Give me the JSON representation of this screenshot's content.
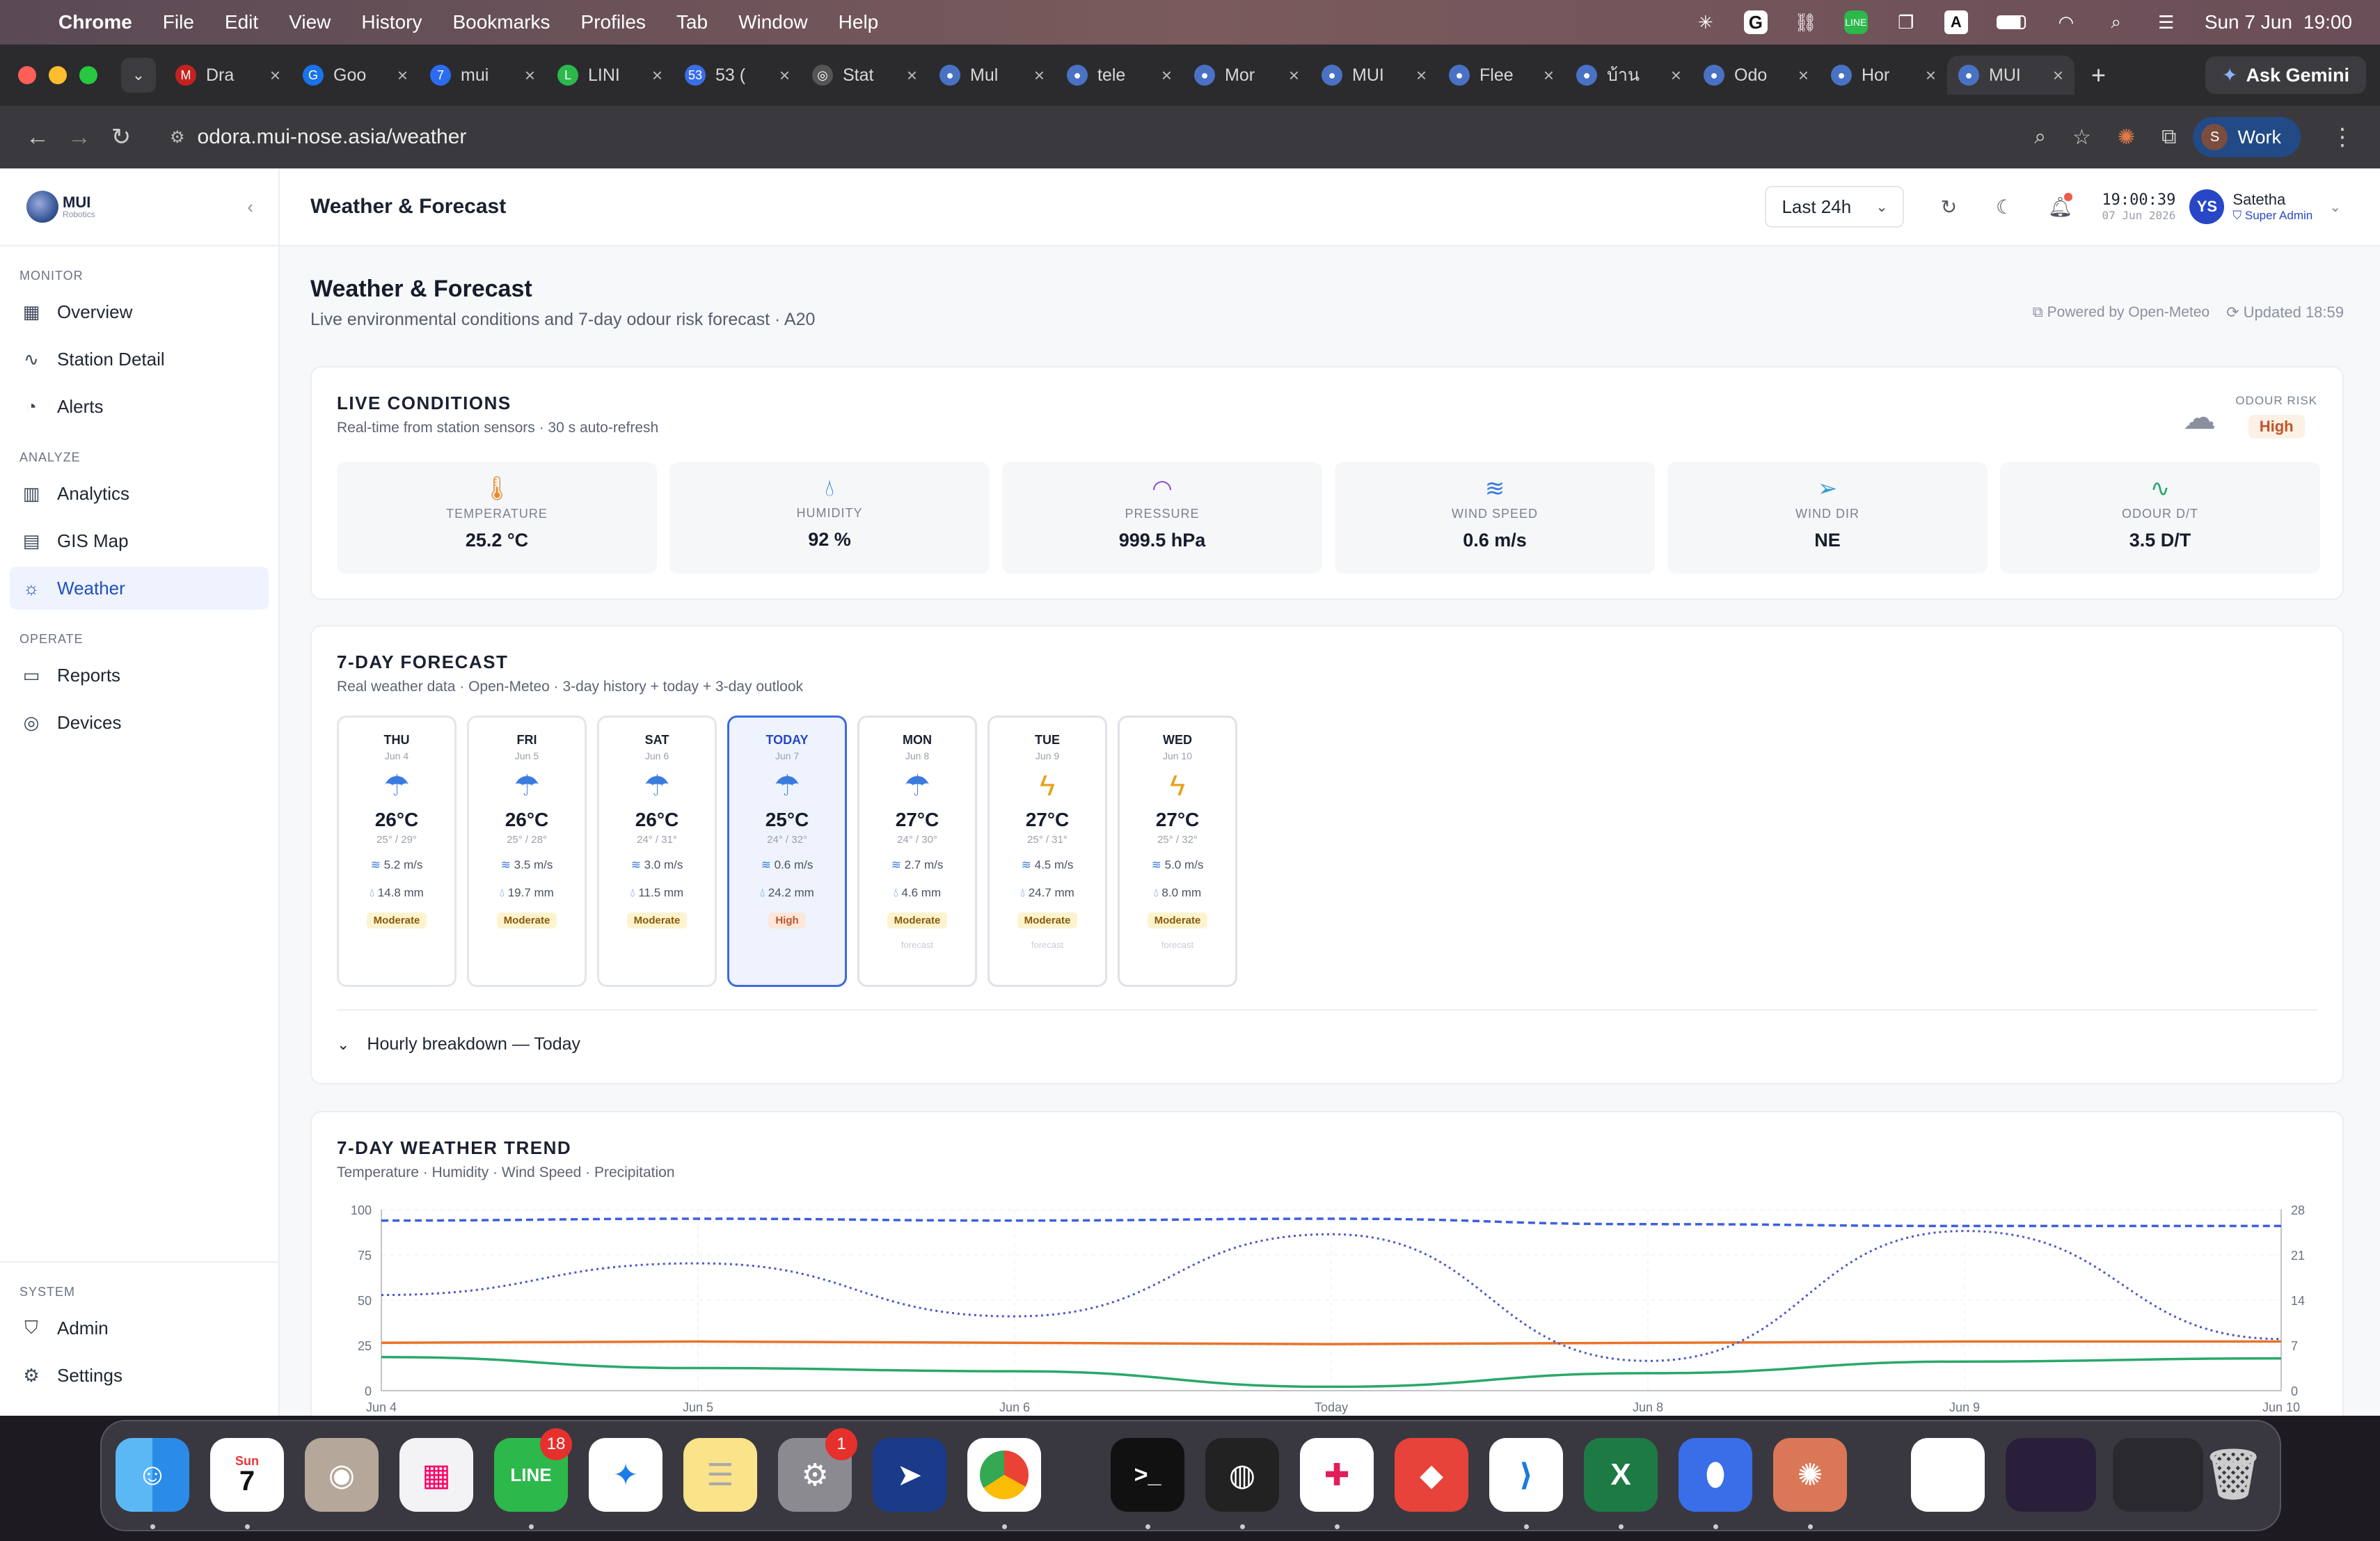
{
  "menubar": {
    "app": "Chrome",
    "items": [
      "File",
      "Edit",
      "View",
      "History",
      "Bookmarks",
      "Profiles",
      "Tab",
      "Window",
      "Help"
    ],
    "date": "Sun 7 Jun",
    "time": "19:00",
    "input_indicator": "A"
  },
  "browser": {
    "tabs": [
      {
        "title": "Dra",
        "color": "#c5221f",
        "glyph": "M"
      },
      {
        "title": "Goo",
        "color": "#1a73e8",
        "glyph": "G"
      },
      {
        "title": "mui",
        "color": "#2b6cf0",
        "glyph": "7"
      },
      {
        "title": "LINI",
        "color": "#2db84c",
        "glyph": "L"
      },
      {
        "title": "53 (",
        "color": "#3a6ee8",
        "glyph": "53"
      },
      {
        "title": "Stat",
        "color": "#555",
        "glyph": "◎"
      },
      {
        "title": "Mul",
        "color": "#4a72c4",
        "glyph": "●"
      },
      {
        "title": "tele",
        "color": "#4a72c4",
        "glyph": "●"
      },
      {
        "title": "Mor",
        "color": "#4a72c4",
        "glyph": "●"
      },
      {
        "title": "MUI",
        "color": "#4a72c4",
        "glyph": "●"
      },
      {
        "title": "Flee",
        "color": "#4a72c4",
        "glyph": "●"
      },
      {
        "title": "บ้าน",
        "color": "#4a72c4",
        "glyph": "●"
      },
      {
        "title": "Odo",
        "color": "#4a72c4",
        "glyph": "●"
      },
      {
        "title": "Hor",
        "color": "#4a72c4",
        "glyph": "●"
      },
      {
        "title": "MUI",
        "color": "#4a72c4",
        "glyph": "●",
        "active": true
      }
    ],
    "gemini": "Ask Gemini",
    "url": "odora.mui-nose.asia/weather",
    "profile": "Work",
    "profile_initial": "S"
  },
  "sidebar": {
    "brand": "MUI",
    "brand_sub": "Robotics",
    "sections": [
      {
        "title": "MONITOR",
        "items": [
          {
            "label": "Overview",
            "icon": "grid-icon"
          },
          {
            "label": "Station Detail",
            "icon": "pulse-icon"
          },
          {
            "label": "Alerts",
            "icon": "bell-icon"
          }
        ]
      },
      {
        "title": "ANALYZE",
        "items": [
          {
            "label": "Analytics",
            "icon": "bar-chart-icon"
          },
          {
            "label": "GIS Map",
            "icon": "map-icon"
          },
          {
            "label": "Weather",
            "icon": "cloud-sun-icon",
            "active": true
          }
        ]
      },
      {
        "title": "OPERATE",
        "items": [
          {
            "label": "Reports",
            "icon": "document-icon"
          },
          {
            "label": "Devices",
            "icon": "cpu-icon"
          }
        ]
      }
    ],
    "system": {
      "title": "SYSTEM",
      "items": [
        {
          "label": "Admin",
          "icon": "shield-icon"
        },
        {
          "label": "Settings",
          "icon": "gear-icon"
        }
      ]
    }
  },
  "topbar": {
    "title": "Weather & Forecast",
    "range": "Last 24h",
    "time": "19:00:39",
    "date": "07 Jun 2026",
    "user_initials": "YS",
    "user_name": "Satetha",
    "user_role": "Super Admin"
  },
  "page": {
    "title": "Weather & Forecast",
    "subtitle": "Live environmental conditions and 7-day odour risk forecast · A20",
    "powered": "Powered by Open-Meteo",
    "updated": "Updated 18:59"
  },
  "live": {
    "title": "LIVE CONDITIONS",
    "subtitle": "Real-time from station sensors · 30 s auto-refresh",
    "odour_risk_label": "ODOUR RISK",
    "odour_risk_value": "High",
    "stats": [
      {
        "label": "TEMPERATURE",
        "value": "25.2 °C",
        "icon": "thermometer-icon",
        "color": "#e8892c"
      },
      {
        "label": "HUMIDITY",
        "value": "92 %",
        "icon": "droplets-icon",
        "color": "#3a7be0"
      },
      {
        "label": "PRESSURE",
        "value": "999.5 hPa",
        "icon": "gauge-icon",
        "color": "#8a4ad0"
      },
      {
        "label": "WIND SPEED",
        "value": "0.6 m/s",
        "icon": "wind-icon",
        "color": "#3a7be0"
      },
      {
        "label": "WIND DIR",
        "value": "NE",
        "icon": "navigation-icon",
        "color": "#3a9ad0"
      },
      {
        "label": "ODOUR D/T",
        "value": "3.5 D/T",
        "icon": "activity-icon",
        "color": "#2aa86a"
      }
    ]
  },
  "forecast": {
    "title": "7-DAY FORECAST",
    "subtitle": "Real weather data · Open-Meteo · 3-day history + today + 3-day outlook",
    "days": [
      {
        "day": "THU",
        "date": "Jun 4",
        "icon": "rain",
        "temp": "26°C",
        "range": "25° / 29°",
        "wind": "5.2 m/s",
        "rain": "14.8 mm",
        "level": "Moderate"
      },
      {
        "day": "FRI",
        "date": "Jun 5",
        "icon": "rain",
        "temp": "26°C",
        "range": "25° / 28°",
        "wind": "3.5 m/s",
        "rain": "19.7 mm",
        "level": "Moderate"
      },
      {
        "day": "SAT",
        "date": "Jun 6",
        "icon": "rain",
        "temp": "26°C",
        "range": "24° / 31°",
        "wind": "3.0 m/s",
        "rain": "11.5 mm",
        "level": "Moderate"
      },
      {
        "day": "TODAY",
        "date": "Jun 7",
        "icon": "rain",
        "temp": "25°C",
        "range": "24° / 32°",
        "wind": "0.6 m/s",
        "rain": "24.2 mm",
        "level": "High",
        "today": true
      },
      {
        "day": "MON",
        "date": "Jun 8",
        "icon": "rain",
        "temp": "27°C",
        "range": "24° / 30°",
        "wind": "2.7 m/s",
        "rain": "4.6 mm",
        "level": "Moderate",
        "note": "forecast"
      },
      {
        "day": "TUE",
        "date": "Jun 9",
        "icon": "storm",
        "temp": "27°C",
        "range": "25° / 31°",
        "wind": "4.5 m/s",
        "rain": "24.7 mm",
        "level": "Moderate",
        "note": "forecast"
      },
      {
        "day": "WED",
        "date": "Jun 10",
        "icon": "storm",
        "temp": "27°C",
        "range": "25° / 32°",
        "wind": "5.0 m/s",
        "rain": "8.0 mm",
        "level": "Moderate",
        "note": "forecast"
      }
    ],
    "hourly": "Hourly breakdown — Today"
  },
  "trend": {
    "title": "7-DAY WEATHER TREND",
    "subtitle": "Temperature · Humidity · Wind Speed · Precipitation"
  },
  "chart_data": {
    "type": "line",
    "categories": [
      "Jun 4",
      "Jun 5",
      "Jun 6",
      "Today",
      "Jun 8",
      "Jun 9",
      "Jun 10"
    ],
    "yleft_ticks": [
      "0",
      "25",
      "50",
      "75",
      "100"
    ],
    "yright_ticks": [
      "0",
      "7",
      "14",
      "21",
      "28"
    ],
    "ylim_left": [
      0,
      100
    ],
    "ylim_right": [
      0,
      28
    ],
    "grid": true,
    "series": [
      {
        "key": "humidity",
        "axis": "left",
        "color": "#3d5fe0",
        "dash": "10,6",
        "values": [
          94,
          95,
          94,
          95,
          92,
          91,
          91
        ]
      },
      {
        "key": "temperature",
        "axis": "right",
        "color": "#e8732a",
        "dash": "",
        "values": [
          7.4,
          7.6,
          7.4,
          7.2,
          7.4,
          7.6,
          7.6
        ]
      },
      {
        "key": "wind_speed",
        "axis": "right",
        "color": "#2aa86a",
        "dash": "",
        "values": [
          5.2,
          3.5,
          3.0,
          0.6,
          2.7,
          4.5,
          5.0
        ]
      },
      {
        "key": "precipitation",
        "axis": "right",
        "color": "#4a58c8",
        "dash": "3,5",
        "values": [
          14.8,
          19.7,
          11.5,
          24.2,
          4.6,
          24.7,
          8.0
        ]
      }
    ]
  },
  "dock": {
    "calendar_month": "Sun",
    "calendar_day": "7",
    "line_badge": "18",
    "settings_badge": "1",
    "line_label": "LINE"
  }
}
